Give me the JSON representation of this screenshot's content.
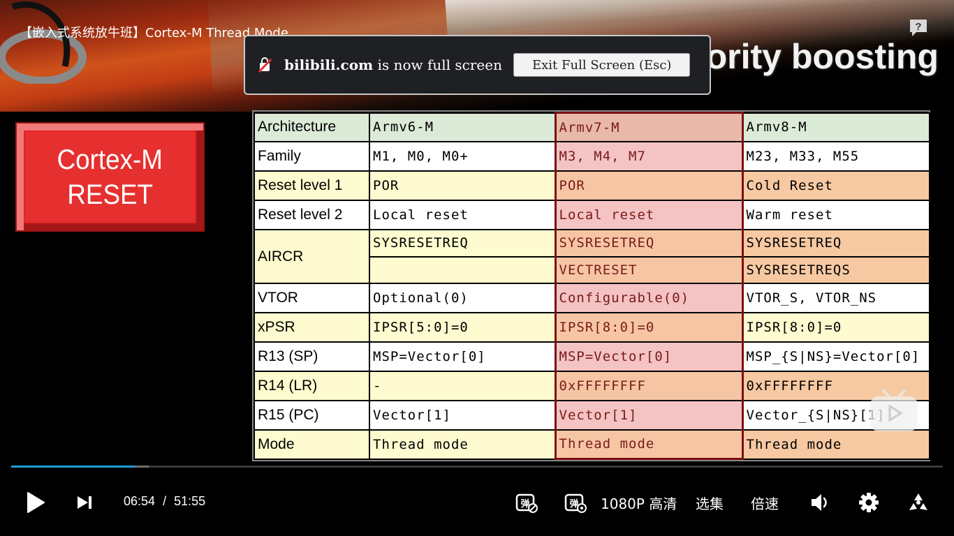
{
  "video": {
    "title": "【嵌入式系统放牛班】Cortex-M Thread Mode",
    "slide_title": "Execution priority and priority boosting",
    "reset_box": {
      "line1": "Cortex-M",
      "line2": "RESET"
    }
  },
  "table": {
    "rows": [
      [
        "Architecture",
        "Armv6-M",
        "Armv7-M",
        "Armv8-M"
      ],
      [
        "Family",
        "M1, M0, M0+",
        "M3, M4, M7",
        "M23, M33, M55"
      ],
      [
        "Reset level 1",
        "POR",
        "POR",
        "Cold Reset"
      ],
      [
        "Reset level 2",
        "Local reset",
        "Local reset",
        "Warm reset"
      ],
      [
        "AIRCR",
        "SYSRESETREQ",
        "SYSRESETREQ",
        "SYSRESETREQ"
      ],
      [
        "",
        "",
        "VECTRESET",
        "SYSRESETREQS"
      ],
      [
        "VTOR",
        "Optional(0)",
        "Configurable(0)",
        "VTOR_S, VTOR_NS"
      ],
      [
        "xPSR",
        "IPSR[5:0]=0",
        "IPSR[8:0]=0",
        "IPSR[8:0]=0"
      ],
      [
        "R13 (SP)",
        "MSP=Vector[0]",
        "MSP=Vector[0]",
        "MSP_{S|NS}=Vector[0]"
      ],
      [
        "R14 (LR)",
        "-",
        "0xFFFFFFFF",
        "0xFFFFFFFF"
      ],
      [
        "R15 (PC)",
        "Vector[1]",
        "Vector[1]",
        "Vector_{S|NS}[1]"
      ],
      [
        "Mode",
        "Thread mode",
        "Thread mode",
        "Thread mode"
      ]
    ],
    "colors": {
      "header_green": "#dcead8",
      "yellow": "#fdfbcf",
      "white": "#ffffff",
      "v7_header": "#e8b8a8",
      "v7_pink": "#f4c3c3",
      "v7_orange": "#f6c6a4",
      "v8_orange": "#f7c9a2"
    }
  },
  "fullscreen_notice": {
    "domain": "bilibili.com",
    "message": " is now full screen",
    "button": "Exit Full Screen (Esc)"
  },
  "player": {
    "current_time": "06:54",
    "separator": "/",
    "duration": "51:55",
    "played_fraction": 0.133,
    "buffered_fraction": 0.148,
    "quality": "1080P 高清",
    "episodes": "选集",
    "speed": "倍速",
    "accent": "#1aa0d8",
    "icons": [
      "play-icon",
      "next-icon",
      "danmaku-toggle-icon",
      "danmaku-settings-icon",
      "volume-icon",
      "settings-icon",
      "fullscreen-icon",
      "help-icon"
    ]
  }
}
